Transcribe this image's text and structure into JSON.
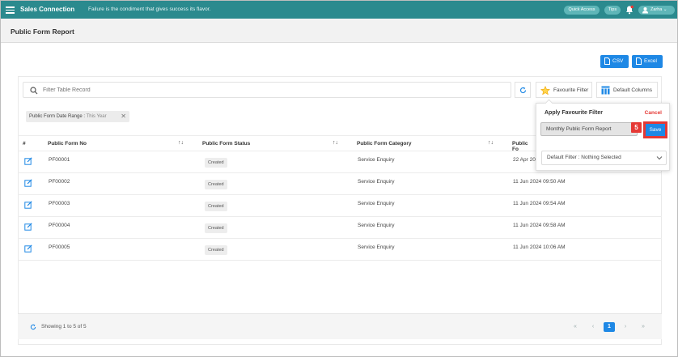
{
  "app": {
    "brand": "Sales Connection",
    "tagline": "Failure is the condiment that gives success its flavor.",
    "quick_access": "Quick Access",
    "tips": "Tips",
    "user_name": "Zarha"
  },
  "page": {
    "title": "Public Form Report"
  },
  "export": {
    "csv_label": "CSV",
    "excel_label": "Excel"
  },
  "search": {
    "placeholder": "Filter Table Record"
  },
  "toolbar": {
    "favourite_filter": "Favourite Filter",
    "default_columns": "Default Columns"
  },
  "filter_chip": {
    "label": "Public Form Date Range : ",
    "value": "This Year",
    "close": "✕"
  },
  "table": {
    "headers": {
      "hash": "#",
      "form_no": "Public Form No",
      "status": "Public Form Status",
      "category": "Public Form Category",
      "created": "Public Fo"
    },
    "sort_glyph": "↑↓",
    "rows": [
      {
        "no": "PF00001",
        "status": "Created",
        "category": "Service Enquiry",
        "date": "22 Apr 20"
      },
      {
        "no": "PF00002",
        "status": "Created",
        "category": "Service Enquiry",
        "date": "11 Jun 2024 09:50 AM"
      },
      {
        "no": "PF00003",
        "status": "Created",
        "category": "Service Enquiry",
        "date": "11 Jun 2024 09:54 AM"
      },
      {
        "no": "PF00004",
        "status": "Created",
        "category": "Service Enquiry",
        "date": "11 Jun 2024 09:58 AM"
      },
      {
        "no": "PF00005",
        "status": "Created",
        "category": "Service Enquiry",
        "date": "11 Jun 2024 10:06 AM"
      }
    ]
  },
  "footer": {
    "showing": "Showing 1 to 5 of 5",
    "pager": {
      "first": "«",
      "prev": "‹",
      "current": "1",
      "next": "›",
      "last": "»"
    }
  },
  "popover": {
    "title": "Apply Favourite Filter",
    "cancel": "Cancel",
    "name_value": "Monthly Public Form Report",
    "step": "5",
    "save": "Save",
    "default_filter_label": "Default Filter :",
    "default_filter_value": "Nothing Selected"
  },
  "colors": {
    "header_bg": "#2b8a8e",
    "primary": "#1e88e5",
    "highlight": "#e53935"
  },
  "icons": [
    "menu-icon",
    "bell-icon",
    "user-icon",
    "search-icon",
    "refresh-icon",
    "star-icon",
    "columns-icon",
    "edit-icon",
    "file-icon",
    "chevron-down-icon"
  ]
}
